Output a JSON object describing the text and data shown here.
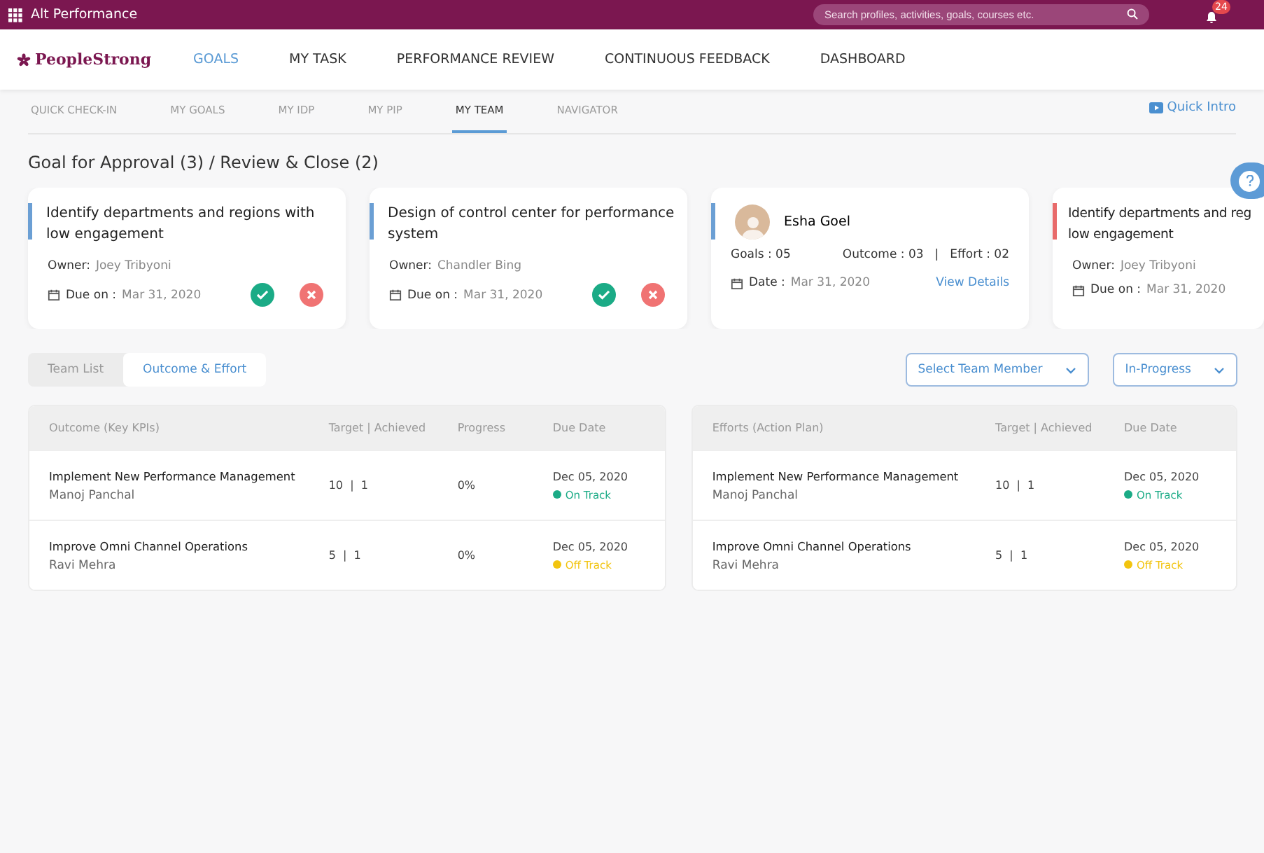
{
  "top_bar": {
    "app_title": "Alt Performance",
    "search": {
      "placeholder": "Search profiles, activities, goals, courses etc."
    },
    "notifications": {
      "count": "24"
    }
  },
  "main_nav": {
    "logo": "PeopleStrong",
    "items": [
      {
        "label": "GOALS",
        "selected": true
      },
      {
        "label": "MY TASK",
        "selected": false
      },
      {
        "label": "PERFORMANCE REVIEW",
        "selected": false
      },
      {
        "label": "CONTINUOUS FEEDBACK",
        "selected": false
      },
      {
        "label": "DASHBOARD",
        "selected": false
      }
    ]
  },
  "sub_tabs": [
    {
      "label": "QUICK CHECK-IN",
      "selected": false
    },
    {
      "label": "MY GOALS",
      "selected": false
    },
    {
      "label": "MY IDP",
      "selected": false
    },
    {
      "label": "MY PIP",
      "selected": false
    },
    {
      "label": "MY TEAM",
      "selected": true
    },
    {
      "label": "NAVIGATOR",
      "selected": false
    }
  ],
  "quick_intro": "Quick Intro",
  "section_title": "Goal for Approval (3) / Review & Close (2)",
  "cards": [
    {
      "kind": "goal",
      "color": "#6b9fd4",
      "title": "Identify departments and regions with low engagement",
      "owner_label": "Owner:",
      "owner": "Joey Tribyoni",
      "due_label": "Due on :",
      "due": "Mar 31, 2020",
      "actions": true
    },
    {
      "kind": "goal",
      "color": "#6b9fd4",
      "title": "Design of control center for performance system",
      "owner_label": "Owner:",
      "owner": "Chandler Bing",
      "due_label": "Due on :",
      "due": "Mar 31, 2020",
      "actions": true
    },
    {
      "kind": "member",
      "color": "#6b9fd4",
      "name": "Esha Goel",
      "goals": "Goals : 05",
      "outcome": "Outcome : 03",
      "separator": "|",
      "effort": "Effort : 02",
      "date_label": "Date :",
      "date": "Mar 31, 2020",
      "link": "View Details"
    },
    {
      "kind": "goal",
      "color": "#e86a6a",
      "title": "Identify departments and reg",
      "title_line_2": "low engagement",
      "owner_label": "Owner:",
      "owner": "Joey Tribyoni",
      "due_label": "Due on :",
      "due": "Mar 31, 2020",
      "actions": false
    }
  ],
  "view_toggle": [
    {
      "label": "Team List",
      "selected": false
    },
    {
      "label": "Outcome & Effort",
      "selected": true
    }
  ],
  "filters": [
    {
      "label": "Select Team Member"
    },
    {
      "label": "In-Progress"
    }
  ],
  "tables": [
    {
      "columns": [
        {
          "kind": "item",
          "label": "Outcome (Key KPIs)"
        },
        {
          "kind": "target",
          "label": "Target | Achieved"
        },
        {
          "kind": "progress",
          "label": "Progress"
        },
        {
          "kind": "due",
          "label": "Due Date"
        }
      ],
      "rows": [
        {
          "title": "Implement New Performance Management",
          "owner": "Manoj Panchal",
          "target": "10  |  1",
          "progress": "0%",
          "due": "Dec 05, 2020",
          "status": {
            "label": "On Track",
            "color": "#1bab86"
          }
        },
        {
          "title": "Improve Omni Channel Operations",
          "owner": "Ravi Mehra",
          "target": "5  |  1",
          "progress": "0%",
          "due": "Dec 05, 2020",
          "status": {
            "label": "Off Track",
            "color": "#f2c40f"
          }
        }
      ]
    },
    {
      "columns": [
        {
          "kind": "item",
          "label": "Efforts (Action Plan)"
        },
        {
          "kind": "target",
          "label": "Target | Achieved"
        },
        {
          "kind": "due",
          "label": "Due Date"
        }
      ],
      "rows": [
        {
          "title": "Implement New Performance Management",
          "owner": "Manoj Panchal",
          "target": "10  |  1",
          "due": "Dec 05, 2020",
          "status": {
            "label": "On Track",
            "color": "#1bab86"
          }
        },
        {
          "title": "Improve Omni Channel Operations",
          "owner": "Ravi Mehra",
          "target": "5  |  1",
          "due": "Dec 05, 2020",
          "status": {
            "label": "Off Track",
            "color": "#f2c40f"
          }
        }
      ]
    }
  ]
}
